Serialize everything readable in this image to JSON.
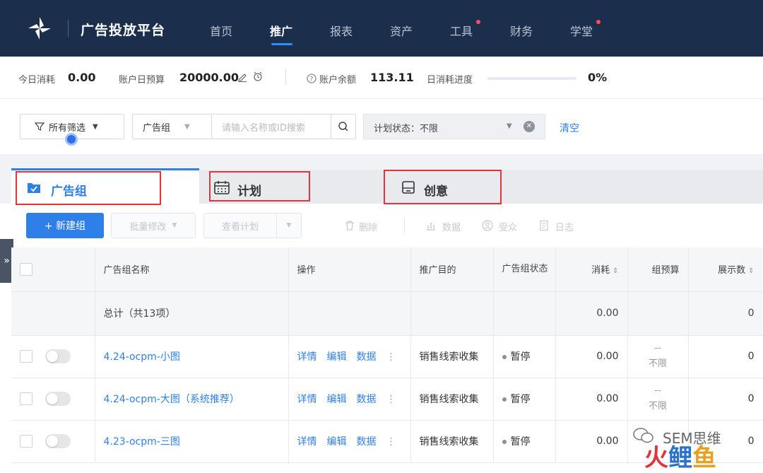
{
  "topbar": {
    "title": "广告投放平台",
    "nav": [
      "首页",
      "推广",
      "报表",
      "资产",
      "工具",
      "财务",
      "学堂"
    ],
    "active": "推广"
  },
  "stats": {
    "today_spend_label": "今日消耗",
    "today_spend": "0.00",
    "daily_budget_label": "账户日预算",
    "daily_budget": "20000.00",
    "balance_label": "账户余额",
    "balance": "113.11",
    "progress_label": "日消耗进度",
    "progress_value": "0%",
    "progress_fraction": 0
  },
  "filters": {
    "all_filters": "所有筛选",
    "scope": "广告组",
    "search_placeholder": "请输入名称或ID搜索",
    "plan_status": "计划状态：不限",
    "clear": "清空"
  },
  "tabs": [
    "广告组",
    "计划",
    "创意"
  ],
  "toolbar": {
    "new_group": "+ 新建组",
    "batch_edit": "批量修改",
    "view_plan": "查看计划",
    "delete": "删除",
    "data": "数据",
    "audience": "受众",
    "log": "日志"
  },
  "table": {
    "headers": [
      "广告组名称",
      "操作",
      "推广目的",
      "广告组状态",
      "消耗",
      "组预算",
      "展示数"
    ],
    "total": {
      "label": "总计（共13项）",
      "spend": "0.00",
      "impressions": "0"
    },
    "ops": [
      "详情",
      "编辑",
      "数据"
    ],
    "rows": [
      {
        "name": "4.24-ocpm-小图",
        "purpose": "销售线索收集",
        "status": "暂停",
        "spend": "0.00",
        "budget_top": "--",
        "budget_bottom": "不限",
        "impressions": "0"
      },
      {
        "name": "4.24-ocpm-大图（系统推荐）",
        "purpose": "销售线索收集",
        "status": "暂停",
        "spend": "0.00",
        "budget_top": "--",
        "budget_bottom": "不限",
        "impressions": "0"
      },
      {
        "name": "4.23-ocpm-三图",
        "purpose": "销售线索收集",
        "status": "暂停",
        "spend": "0.00",
        "budget_top": "",
        "budget_bottom": "",
        "impressions": "0"
      }
    ]
  },
  "watermark": {
    "text": "SEM思维",
    "brand": "火鲤鱼"
  },
  "side_handle": "»",
  "colors": {
    "nav_bg": "#1b2f4c",
    "accent": "#2f7fe8",
    "highlight": "#e0353b"
  }
}
